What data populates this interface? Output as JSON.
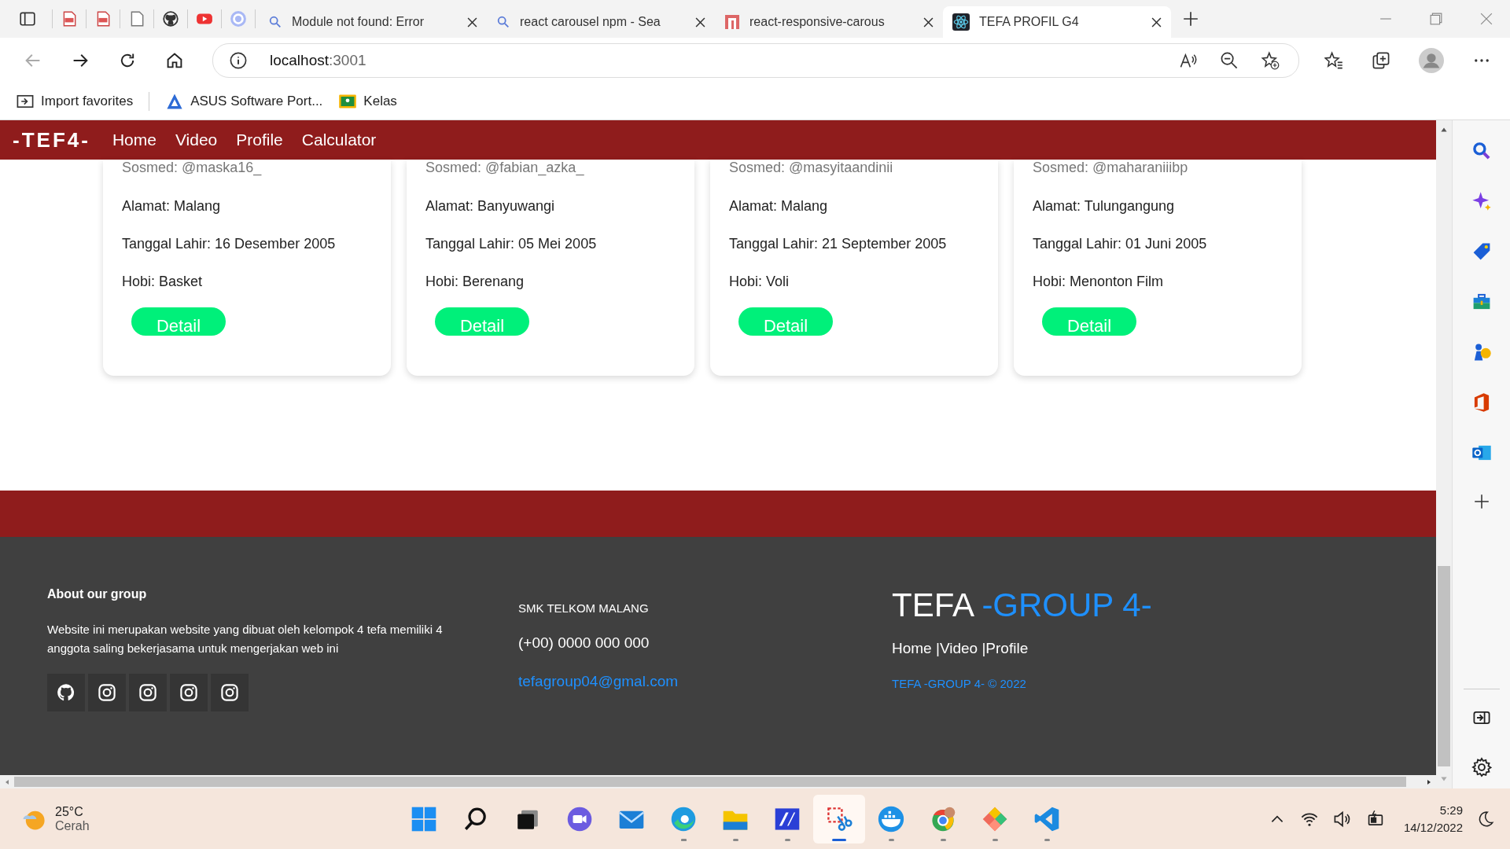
{
  "browser": {
    "tabs": [
      {
        "title": "Module not found: Error",
        "selected": false
      },
      {
        "title": "react carousel npm - Sea",
        "selected": false
      },
      {
        "title": "react-responsive-carous",
        "selected": false
      },
      {
        "title": "TEFA PROFIL G4",
        "selected": true
      }
    ],
    "address": {
      "host": "localhost",
      "port": ":3001"
    },
    "bookmarks": [
      "Import favorites",
      "ASUS Software Port...",
      "Kelas"
    ]
  },
  "navbar": {
    "brand": "-TEF4-",
    "links": [
      "Home",
      "Video",
      "Profile",
      "Calculator"
    ]
  },
  "cards": [
    {
      "sosmed": "Sosmed: @maska16_",
      "alamat": "Alamat: Malang",
      "lahir": "Tanggal Lahir: 16 Desember 2005",
      "hobi": "Hobi: Basket",
      "button": "Detail"
    },
    {
      "sosmed": "Sosmed: @fabian_azka_",
      "alamat": "Alamat: Banyuwangi",
      "lahir": "Tanggal Lahir: 05 Mei 2005",
      "hobi": "Hobi: Berenang",
      "button": "Detail"
    },
    {
      "sosmed": "Sosmed: @masyitaandinii",
      "alamat": "Alamat: Malang",
      "lahir": "Tanggal Lahir: 21 September 2005",
      "hobi": "Hobi: Voli",
      "button": "Detail"
    },
    {
      "sosmed": "Sosmed: @maharaniiibp",
      "alamat": "Alamat: Tulungangung",
      "lahir": "Tanggal Lahir: 01 Juni 2005",
      "hobi": "Hobi: Menonton Film",
      "button": "Detail"
    }
  ],
  "footer": {
    "about_title": "About our group",
    "about_text": "Website ini merupakan website yang dibuat oleh kelompok 4 tefa memiliki 4 anggota saling bekerjasama untuk mengerjakan web ini",
    "socials": [
      {
        "kind": "github"
      },
      {
        "kind": "instagram"
      },
      {
        "kind": "instagram"
      },
      {
        "kind": "instagram"
      },
      {
        "kind": "instagram"
      }
    ],
    "school": "SMK TELKOM MALANG",
    "phone": "(+00) 0000 000 000",
    "email": "tefagroup04@gmal.com",
    "brand_main": "TEFA",
    "brand_accent": "-GROUP 4-",
    "links": [
      "Home ",
      "|Video ",
      "|Profile"
    ],
    "copyright": "TEFA -GROUP 4- © 2022"
  },
  "taskbar": {
    "temperature": "25°C",
    "weather": "Cerah",
    "time": "5:29",
    "date": "14/12/2022"
  }
}
